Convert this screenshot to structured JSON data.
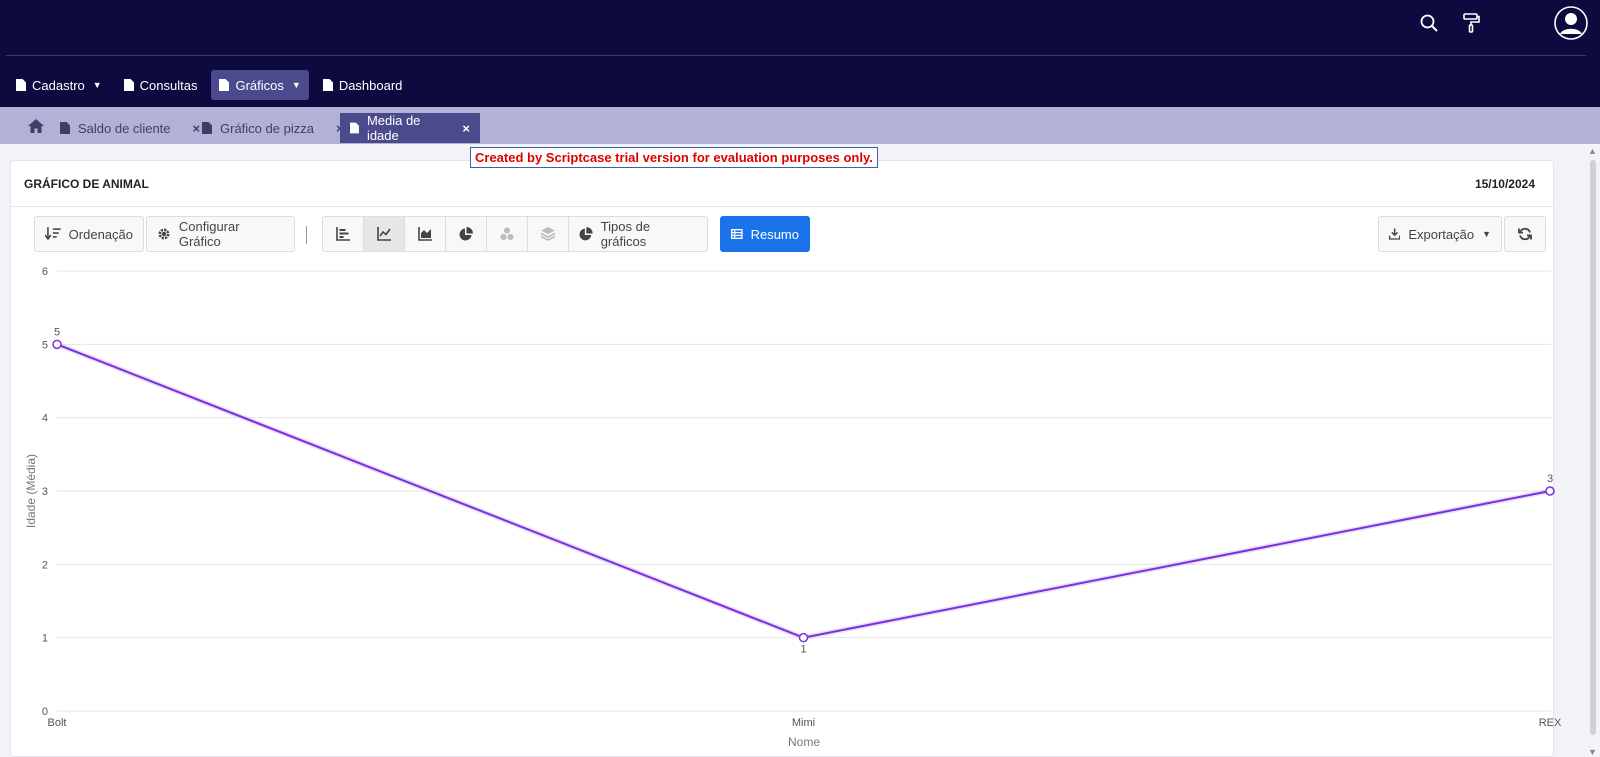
{
  "header": {
    "icons": [
      "search-icon",
      "paint-roller-icon",
      "user-avatar-icon"
    ]
  },
  "menu": {
    "items": [
      {
        "label": "Cadastro",
        "icon": "document-icon",
        "dropdown": true
      },
      {
        "label": "Consultas",
        "icon": "document-icon",
        "dropdown": false
      },
      {
        "label": "Gráficos",
        "icon": "document-icon",
        "dropdown": true,
        "active": true
      },
      {
        "label": "Dashboard",
        "icon": "document-icon",
        "dropdown": false
      }
    ]
  },
  "tabs": [
    {
      "label": "Saldo de cliente",
      "close": "×"
    },
    {
      "label": "Gráfico de pizza",
      "close": "×"
    },
    {
      "label": "Media de idade",
      "close": "×",
      "active": true
    }
  ],
  "trial_banner": "Created by Scriptcase trial version for evaluation purposes only.",
  "card": {
    "title": "GRÁFICO DE ANIMAL",
    "date": "15/10/2024"
  },
  "toolbar": {
    "sort_label": "Ordenação",
    "config_label": "Configurar Gráfico",
    "chart_types_label": "Tipos de gráficos",
    "summary_label": "Resumo",
    "export_label": "Exportação"
  },
  "colors": {
    "topbar": "#0c0a3e",
    "tabbar": "#b3b2d6",
    "active_tab": "#4b4a8c",
    "primary_button": "#1a73e8",
    "series_line": "#7b2fe0",
    "trial_text": "#e00000"
  },
  "chart_data": {
    "type": "line",
    "categories": [
      "Bolt",
      "Mimi",
      "REX"
    ],
    "series": [
      {
        "values": [
          5,
          1,
          3
        ]
      }
    ],
    "data_labels": [
      "5",
      "1",
      "3"
    ],
    "xlabel": "Nome",
    "ylabel": "Idade (Média)",
    "ylim": [
      0,
      6
    ],
    "yticks": [
      "0",
      "1",
      "2",
      "3",
      "4",
      "5",
      "6"
    ],
    "grid": true
  }
}
